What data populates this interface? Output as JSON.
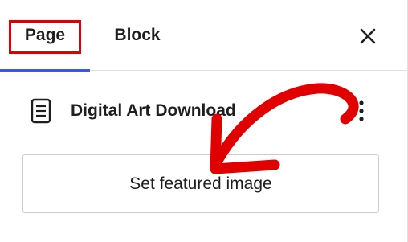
{
  "tabs": {
    "page_label": "Page",
    "block_label": "Block",
    "active": "Page"
  },
  "header": {
    "close_icon": "close-icon"
  },
  "summary": {
    "title": "Digital Art Download",
    "icon": "page-document-icon",
    "more_icon": "more-vertical-icon"
  },
  "featured_image": {
    "label": "Set featured image"
  },
  "colors": {
    "accent": "#3858e9",
    "annotation": "#e10000",
    "text": "#1e1e1e",
    "border": "#cccccc"
  }
}
